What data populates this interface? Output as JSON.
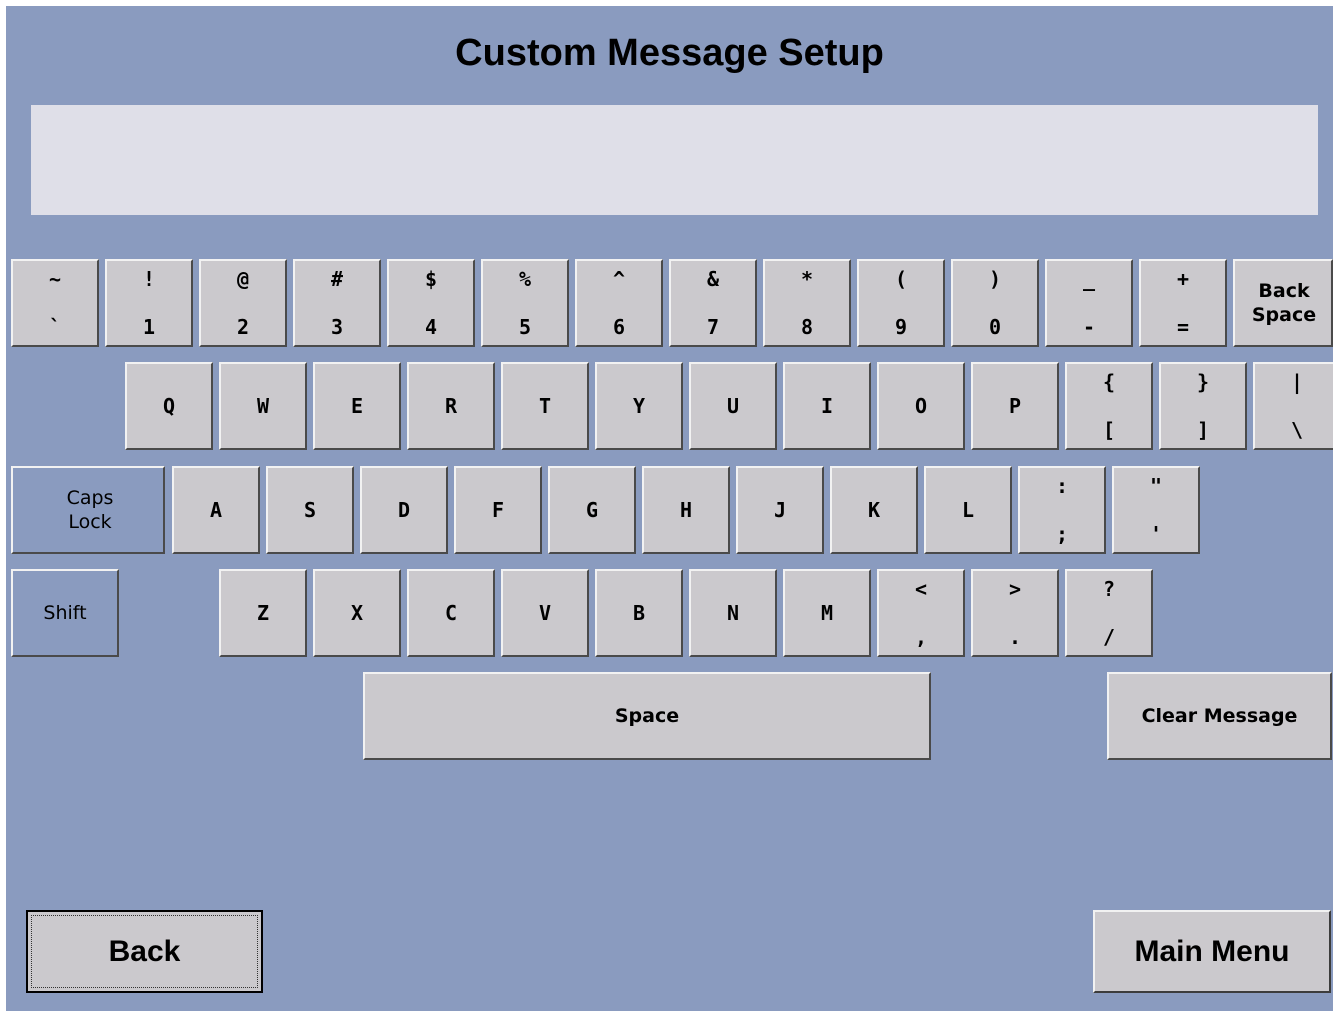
{
  "title": "Custom Message Setup",
  "message": "",
  "keys": {
    "tilde": {
      "top": "~",
      "bot": "`"
    },
    "k1": {
      "top": "!",
      "bot": "1"
    },
    "k2": {
      "top": "@",
      "bot": "2"
    },
    "k3": {
      "top": "#",
      "bot": "3"
    },
    "k4": {
      "top": "$",
      "bot": "4"
    },
    "k5": {
      "top": "%",
      "bot": "5"
    },
    "k6": {
      "top": "^",
      "bot": "6"
    },
    "k7": {
      "top": "&",
      "bot": "7"
    },
    "k8": {
      "top": "*",
      "bot": "8"
    },
    "k9": {
      "top": "(",
      "bot": "9"
    },
    "k0": {
      "top": ")",
      "bot": "0"
    },
    "minus": {
      "top": "_",
      "bot": "-"
    },
    "equals": {
      "top": "+",
      "bot": "="
    },
    "backspace": "Back Space",
    "q": "Q",
    "w": "W",
    "e": "E",
    "r": "R",
    "t": "T",
    "y": "Y",
    "u": "U",
    "i": "I",
    "o": "O",
    "p": "P",
    "lbrace": {
      "top": "{",
      "bot": "["
    },
    "rbrace": {
      "top": "}",
      "bot": "]"
    },
    "pipe": {
      "top": "|",
      "bot": "\\"
    },
    "capslock": "Caps Lock",
    "a": "A",
    "s": "S",
    "d": "D",
    "f": "F",
    "g": "G",
    "h": "H",
    "j": "J",
    "k": "K",
    "l": "L",
    "colon": {
      "top": ":",
      "bot": ";"
    },
    "quote": {
      "top": "\"",
      "bot": "'"
    },
    "shift": "Shift",
    "z": "Z",
    "x": "X",
    "c": "C",
    "v": "V",
    "b": "B",
    "n": "N",
    "m": "M",
    "lt": {
      "top": "<",
      "bot": ","
    },
    "gt": {
      "top": ">",
      "bot": "."
    },
    "question": {
      "top": "?",
      "bot": "/"
    },
    "space": "Space",
    "clear": "Clear Message"
  },
  "nav": {
    "back": "Back",
    "main_menu": "Main Menu"
  }
}
